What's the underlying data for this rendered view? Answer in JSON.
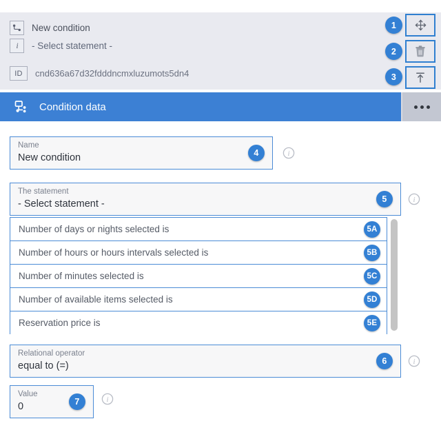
{
  "summary": {
    "condition_icon": "condition-node-icon",
    "condition_name": "New condition",
    "info_icon": "info-italic-icon",
    "statement_summary": "- Select statement -",
    "id_label": "ID",
    "id_value": "cnd636a67d32fdddncmxluzumots5dn4"
  },
  "toolbar": {
    "buttons": [
      {
        "name": "move-button",
        "icon": "move-arrows-icon",
        "badge": "1"
      },
      {
        "name": "delete-button",
        "icon": "trash-icon",
        "badge": "2"
      },
      {
        "name": "move-to-top-button",
        "icon": "arrow-to-top-icon",
        "badge": "3"
      }
    ]
  },
  "header": {
    "icon": "condition-data-flow-icon",
    "title": "Condition data",
    "overflow_label": "more-options"
  },
  "fields": {
    "name": {
      "label": "Name",
      "value": "New condition",
      "badge": "4"
    },
    "statement": {
      "label": "The statement",
      "value": "- Select statement -",
      "badge": "5"
    },
    "operator": {
      "label": "Relational operator",
      "value": "equal to (=)",
      "badge": "6"
    },
    "value": {
      "label": "Value",
      "value": "0",
      "badge": "7"
    }
  },
  "statement_options": [
    {
      "label": "Number of days or nights selected is",
      "badge": "5A"
    },
    {
      "label": "Number of hours or hours intervals selected is",
      "badge": "5B"
    },
    {
      "label": "Number of minutes selected is",
      "badge": "5C"
    },
    {
      "label": "Number of available items selected is",
      "badge": "5D"
    },
    {
      "label": "Reservation price is",
      "badge": "5E"
    }
  ],
  "colors": {
    "accent_blue": "#3c80d4",
    "badge_blue": "#3380d4",
    "panel_gray": "#e9eaf0",
    "field_border": "#4a8bd6",
    "overflow_gray": "#c3c7d2"
  }
}
